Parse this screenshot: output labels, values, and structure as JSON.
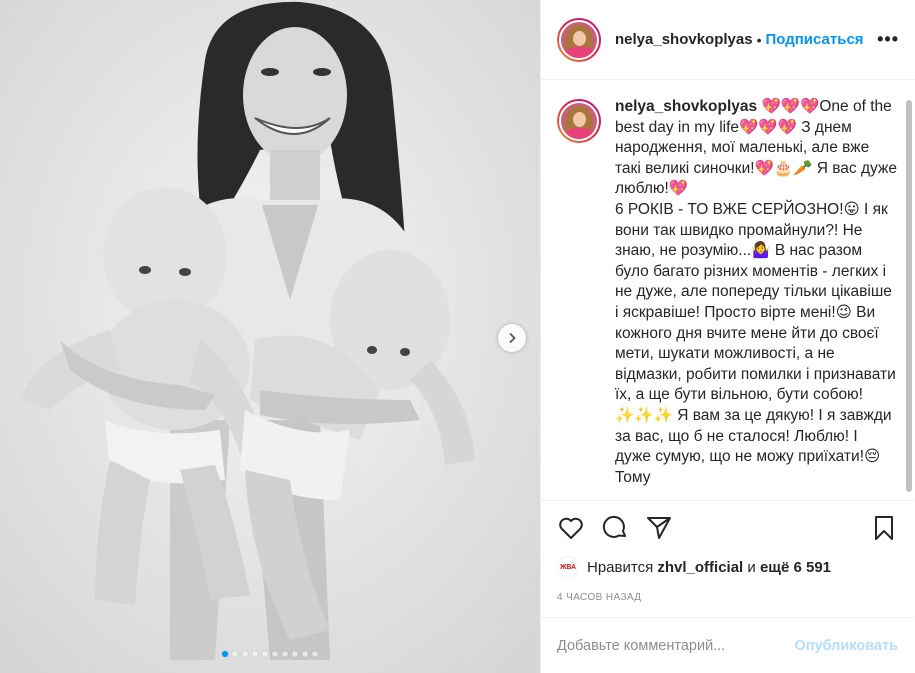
{
  "post": {
    "username": "nelya_shovkoplyas",
    "separator": "•",
    "follow_label": "Подписаться",
    "more_label": "•••"
  },
  "caption": {
    "username": "nelya_shovkoplyas",
    "text": " 💖💖💖One of the best day in my life💖💖💖 З днем народження, мої маленькі, але вже такі великі синочки!💖🎂🥕 Я вас дуже люблю!💖\n6 РОКІВ - ТО ВЖЕ СЕРЙОЗНО!😛 І як вони так швидко промайнули?! Не знаю, не розумію...🤷‍♀️ В нас разом було багато різних моментів - легких і не дуже, але попереду тільки цікавіше і яскравіше! Просто вірте мені!😉 Ви кожного дня вчите мене йти до своєї мети, шукати можливості, а не відмазки, робити помилки і признавати їх, а ще бути вільною, бути собою!✨✨✨ Я вам за це дякую! І я завжди за вас, що б не сталося! Люблю! І дуже сумую, що не можу приїхати!😔 Тому"
  },
  "likes": {
    "avatar_text": "ЖВА",
    "prefix": "Нравится",
    "user": "zhvl_official",
    "middle": "и",
    "count_text": "ещё 6 591"
  },
  "timestamp": "4 ЧАСОВ НАЗАД",
  "comment": {
    "placeholder": "Добавьте комментарий...",
    "publish_label": "Опубликовать"
  },
  "carousel": {
    "total_dots": 10,
    "active_index": 0
  },
  "colors": {
    "accent": "#0095f6",
    "publish_disabled": "#b2dffc",
    "text": "#262626",
    "muted": "#8e8e8e"
  },
  "icons": [
    "heart-icon",
    "comment-icon",
    "share-icon",
    "bookmark-icon",
    "chevron-right-icon",
    "more-icon"
  ]
}
